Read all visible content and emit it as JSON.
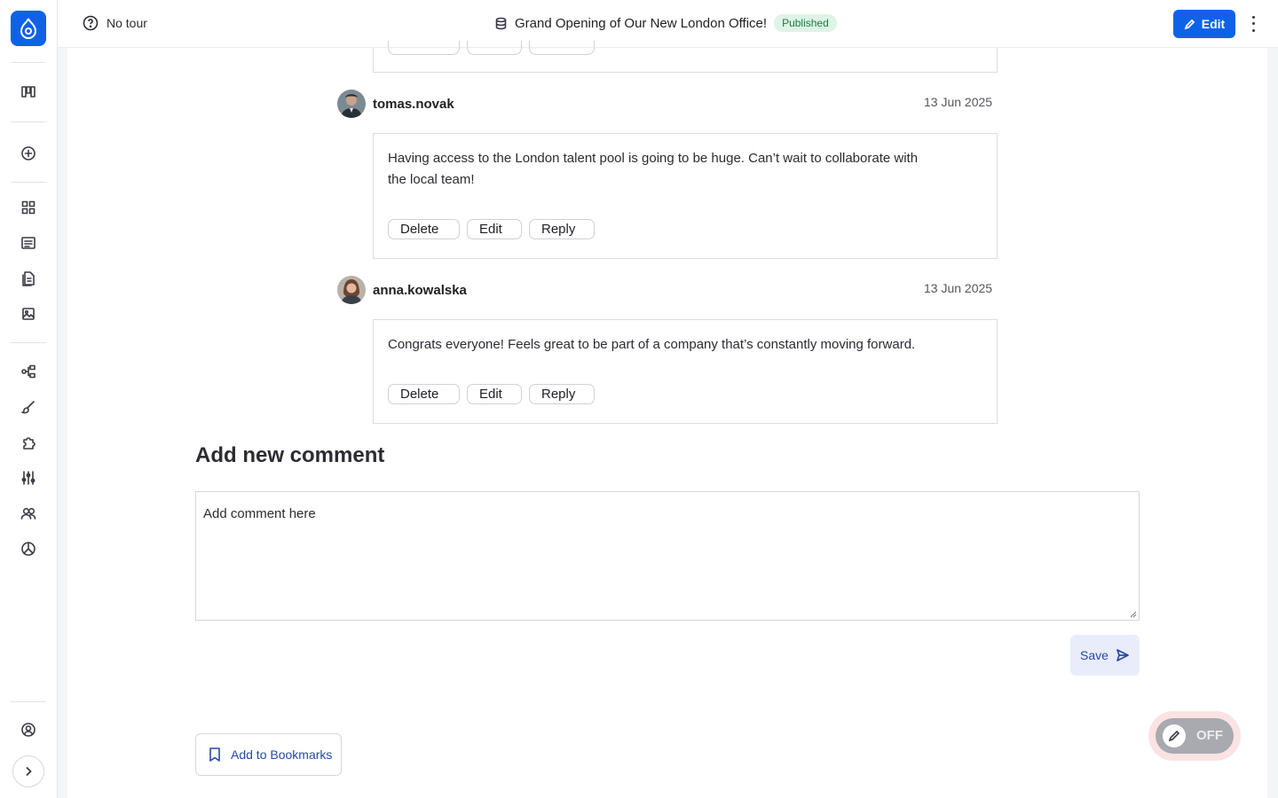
{
  "topbar": {
    "tour_label": "No tour",
    "page_title": "Grand Opening of Our New London Office!",
    "status_badge": "Published",
    "edit_label": "Edit"
  },
  "comments": [
    {
      "author": "tomas.novak",
      "date": "13 Jun 2025",
      "text_line1": "Having access to the London talent pool is going to be huge. Can’t wait to collaborate with",
      "text_line2": "the local team!",
      "actions": [
        "Delete",
        "Edit",
        "Reply"
      ]
    },
    {
      "author": "anna.kowalska",
      "date": "13 Jun 2025",
      "text_line1": "Congrats everyone! Feels great to be part of a company that’s constantly moving forward.",
      "actions": [
        "Delete",
        "Edit",
        "Reply"
      ]
    }
  ],
  "add_comment": {
    "title": "Add new comment",
    "placeholder": "Add comment here",
    "save_label": "Save"
  },
  "bookmark_label": "Add to Bookmarks",
  "edit_mode_toggle": {
    "label": "OFF"
  },
  "colors": {
    "accent": "#0f62e8",
    "link": "#2748a8",
    "badge_bg": "#dff3e6",
    "badge_text": "#1e7a45"
  }
}
